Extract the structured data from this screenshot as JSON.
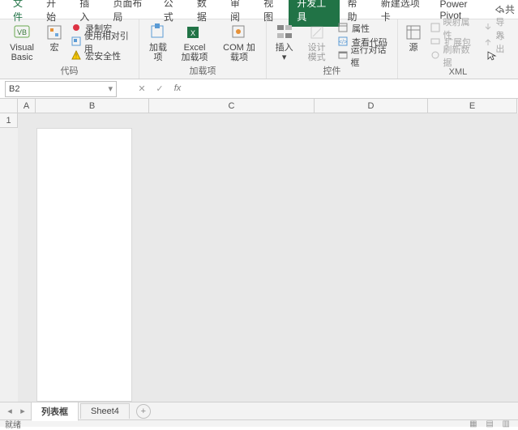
{
  "tabs": {
    "file": "文件",
    "home": "开始",
    "insert": "插入",
    "layout": "页面布局",
    "formula": "公式",
    "data": "数据",
    "review": "审阅",
    "view": "视图",
    "dev": "开发工具",
    "help": "帮助",
    "newtab": "新建选项卡",
    "powerpivot": "Power Pivot"
  },
  "share": "共",
  "ribbon": {
    "code": {
      "label": "代码",
      "visualbasic": "Visual Basic",
      "macro": "宏",
      "record": "录制宏",
      "relref": "使用相对引用",
      "security": "宏安全性"
    },
    "addins": {
      "label": "加载项",
      "addin": "加载项",
      "exceladdin": "Excel 加载项",
      "comaddin": "COM 加载项"
    },
    "controls": {
      "label": "控件",
      "insert": "插入",
      "design": "设计模式",
      "properties": "属性",
      "viewcode": "查看代码",
      "rundialog": "运行对话框"
    },
    "xml": {
      "label": "XML",
      "source": "源",
      "mapprops": "映射属性",
      "expansion": "扩展包",
      "refresh": "刷新数据",
      "import": "导入",
      "export": "导出"
    }
  },
  "namebox": "B2",
  "colwidths": {
    "A": 22,
    "B": 140,
    "C": 204,
    "D": 140,
    "E": 80
  },
  "sheets": {
    "active": "列表框",
    "other": "Sheet4"
  },
  "status": {
    "left": "就绪"
  }
}
